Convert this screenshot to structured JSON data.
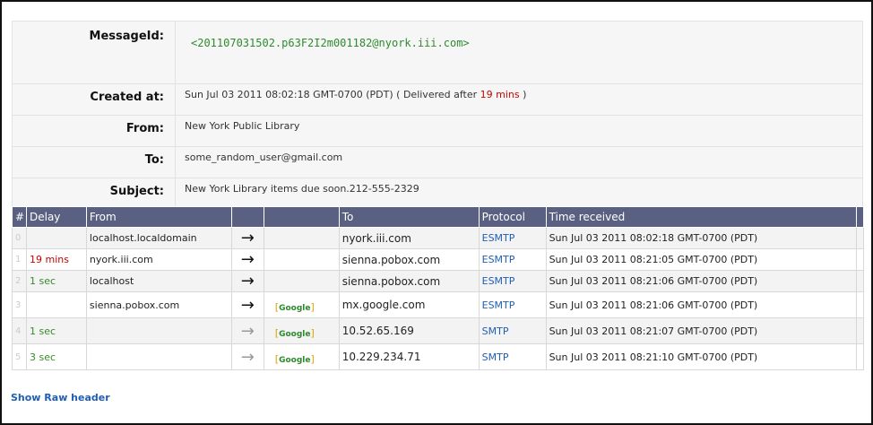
{
  "summary": {
    "message_id_label": "MessageId:",
    "message_id": "<201107031502.p63F2I2m001182@nyork.iii.com>",
    "created_label": "Created at:",
    "created_value": "Sun Jul 03 2011 08:02:18 GMT-0700 (PDT)",
    "delivered_prefix": "( Delivered after",
    "delivered_delay": "19 mins",
    "delivered_suffix": ")",
    "from_label": "From:",
    "from_value": "New York Public Library",
    "to_label": "To:",
    "to_value": "some_random_user@gmail.com",
    "subject_label": "Subject:",
    "subject_value": "New York Library items due soon.212-555-2329"
  },
  "hops": {
    "headers": [
      "#",
      "Delay",
      "From",
      "",
      "",
      "To",
      "Protocol",
      "Time received"
    ],
    "rows": [
      {
        "num": "0",
        "delay": "",
        "from": "localhost.localdomain",
        "arrow": "→",
        "tag": "",
        "to": "nyork.iii.com",
        "protocol": "ESMTP",
        "time": "Sun Jul 03 2011 08:02:18 GMT-0700 (PDT)"
      },
      {
        "num": "1",
        "delay": "19 mins",
        "from": "nyork.iii.com",
        "arrow": "→",
        "tag": "",
        "to": "sienna.pobox.com",
        "protocol": "ESMTP",
        "time": "Sun Jul 03 2011 08:21:05 GMT-0700 (PDT)"
      },
      {
        "num": "2",
        "delay": "1 sec",
        "from": "localhost",
        "arrow": "→",
        "tag": "",
        "to": "sienna.pobox.com",
        "protocol": "ESMTP",
        "time": "Sun Jul 03 2011 08:21:06 GMT-0700 (PDT)"
      },
      {
        "num": "3",
        "delay": "",
        "from": "sienna.pobox.com",
        "arrow": "→",
        "tag": "Google",
        "to": "mx.google.com",
        "protocol": "ESMTP",
        "time": "Sun Jul 03 2011 08:21:06 GMT-0700 (PDT)"
      },
      {
        "num": "4",
        "delay": "1 sec",
        "from": "",
        "arrow": "→",
        "tag": "Google",
        "to": "10.52.65.169",
        "protocol": "SMTP",
        "time": "Sun Jul 03 2011 08:21:07 GMT-0700 (PDT)"
      },
      {
        "num": "5",
        "delay": "3 sec",
        "from": "",
        "arrow": "→",
        "tag": "Google",
        "to": "10.229.234.71",
        "protocol": "SMTP",
        "time": "Sun Jul 03 2011 08:21:10 GMT-0700 (PDT)"
      }
    ]
  },
  "show_raw_label": "Show Raw header",
  "colors": {
    "header_bg": "#5a6081",
    "delay_red": "#cc0000",
    "delay_green": "#3a8a2a",
    "link_blue": "#1f5fb3",
    "google_green": "#2f8a2f"
  }
}
